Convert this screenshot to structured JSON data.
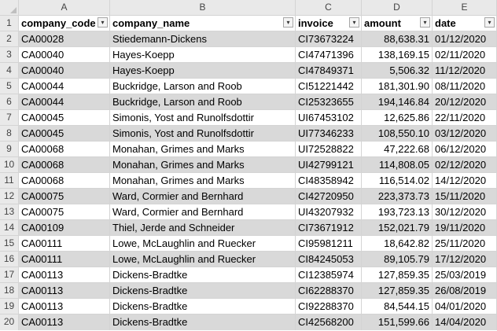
{
  "sheet": {
    "column_letters": [
      "A",
      "B",
      "C",
      "D",
      "E"
    ],
    "header_row_number": "1",
    "headers": {
      "company_code": "company_code",
      "company_name": "company_name",
      "invoice": "invoice",
      "amount": "amount",
      "date": "date"
    },
    "filter_icons": {
      "company_code": "sort-ascending-filter-icon",
      "others": "dropdown-filter-icon"
    },
    "shade_color": "#d9d9d9",
    "rows": [
      {
        "num": "2",
        "code": "CA00028",
        "name": "Stiedemann-Dickens",
        "invoice": "CI73673224",
        "amount": "88,638.31",
        "date": "01/12/2020"
      },
      {
        "num": "3",
        "code": "CA00040",
        "name": "Hayes-Koepp",
        "invoice": "CI47471396",
        "amount": "138,169.15",
        "date": "02/11/2020"
      },
      {
        "num": "4",
        "code": "CA00040",
        "name": "Hayes-Koepp",
        "invoice": "CI47849371",
        "amount": "5,506.32",
        "date": "11/12/2020"
      },
      {
        "num": "5",
        "code": "CA00044",
        "name": "Buckridge, Larson and Roob",
        "invoice": "CI51221442",
        "amount": "181,301.90",
        "date": "08/11/2020"
      },
      {
        "num": "6",
        "code": "CA00044",
        "name": "Buckridge, Larson and Roob",
        "invoice": "CI25323655",
        "amount": "194,146.84",
        "date": "20/12/2020"
      },
      {
        "num": "7",
        "code": "CA00045",
        "name": "Simonis, Yost and Runolfsdottir",
        "invoice": "UI67453102",
        "amount": "12,625.86",
        "date": "22/11/2020"
      },
      {
        "num": "8",
        "code": "CA00045",
        "name": "Simonis, Yost and Runolfsdottir",
        "invoice": "UI77346233",
        "amount": "108,550.10",
        "date": "03/12/2020"
      },
      {
        "num": "9",
        "code": "CA00068",
        "name": "Monahan, Grimes and Marks",
        "invoice": "UI72528822",
        "amount": "47,222.68",
        "date": "06/12/2020"
      },
      {
        "num": "10",
        "code": "CA00068",
        "name": "Monahan, Grimes and Marks",
        "invoice": "UI42799121",
        "amount": "114,808.05",
        "date": "02/12/2020"
      },
      {
        "num": "11",
        "code": "CA00068",
        "name": "Monahan, Grimes and Marks",
        "invoice": "CI48358942",
        "amount": "116,514.02",
        "date": "14/12/2020"
      },
      {
        "num": "12",
        "code": "CA00075",
        "name": "Ward, Cormier and Bernhard",
        "invoice": "CI42720950",
        "amount": "223,373.73",
        "date": "15/11/2020"
      },
      {
        "num": "13",
        "code": "CA00075",
        "name": "Ward, Cormier and Bernhard",
        "invoice": "UI43207932",
        "amount": "193,723.13",
        "date": "30/12/2020"
      },
      {
        "num": "14",
        "code": "CA00109",
        "name": "Thiel, Jerde and Schneider",
        "invoice": "CI73671912",
        "amount": "152,021.79",
        "date": "19/11/2020"
      },
      {
        "num": "15",
        "code": "CA00111",
        "name": "Lowe, McLaughlin and Ruecker",
        "invoice": "CI95981211",
        "amount": "18,642.82",
        "date": "25/11/2020"
      },
      {
        "num": "16",
        "code": "CA00111",
        "name": "Lowe, McLaughlin and Ruecker",
        "invoice": "CI84245053",
        "amount": "89,105.79",
        "date": "17/12/2020"
      },
      {
        "num": "17",
        "code": "CA00113",
        "name": "Dickens-Bradtke",
        "invoice": "CI12385974",
        "amount": "127,859.35",
        "date": "25/03/2019"
      },
      {
        "num": "18",
        "code": "CA00113",
        "name": "Dickens-Bradtke",
        "invoice": "CI62288370",
        "amount": "127,859.35",
        "date": "26/08/2019"
      },
      {
        "num": "19",
        "code": "CA00113",
        "name": "Dickens-Bradtke",
        "invoice": "CI92288370",
        "amount": "84,544.15",
        "date": "04/01/2020"
      },
      {
        "num": "20",
        "code": "CA00113",
        "name": "Dickens-Bradtke",
        "invoice": "CI42568200",
        "amount": "151,599.66",
        "date": "14/04/2020"
      }
    ]
  }
}
